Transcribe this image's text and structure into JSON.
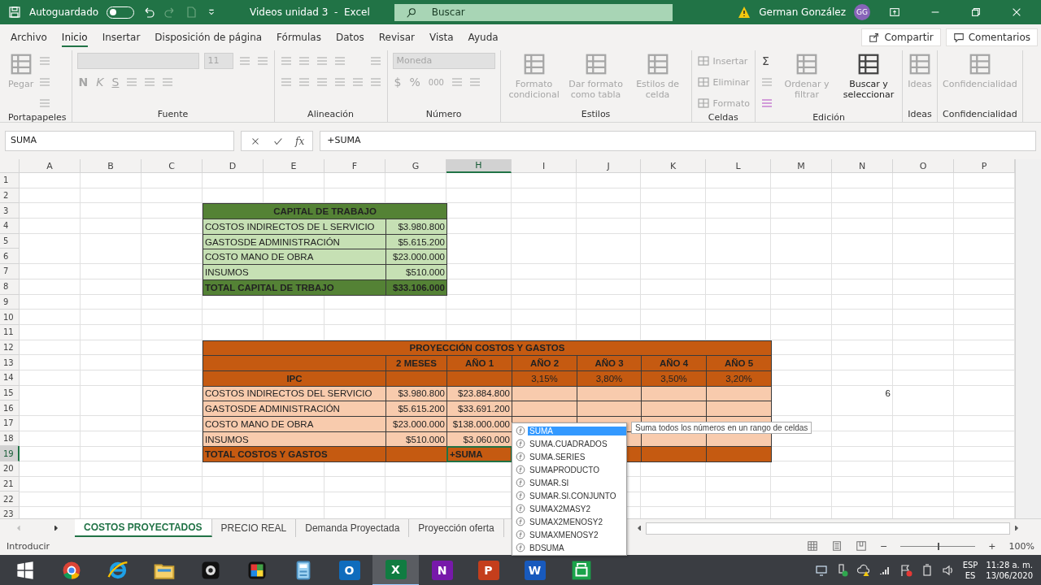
{
  "title_bar": {
    "autosave_label": "Autoguardado",
    "autosave_on": false,
    "document_title": "Videos unidad 3  -  Excel",
    "search_placeholder": "Buscar",
    "user_name": "German González",
    "user_initials": "GG"
  },
  "menu_tabs": [
    {
      "label": "Archivo",
      "selected": false
    },
    {
      "label": "Inicio",
      "selected": true
    },
    {
      "label": "Insertar",
      "selected": false
    },
    {
      "label": "Disposición de página",
      "selected": false
    },
    {
      "label": "Fórmulas",
      "selected": false
    },
    {
      "label": "Datos",
      "selected": false
    },
    {
      "label": "Revisar",
      "selected": false
    },
    {
      "label": "Vista",
      "selected": false
    },
    {
      "label": "Ayuda",
      "selected": false
    }
  ],
  "share_button": "Compartir",
  "comments_button": "Comentarios",
  "ribbon": {
    "disabled": true,
    "groups": [
      {
        "label": "Portapapeles",
        "columns": [
          [
            [
              {
                "kind": "big",
                "label": "Pegar"
              }
            ]
          ],
          [
            [
              {
                "kind": "icon"
              }
            ],
            [
              {
                "kind": "icon"
              }
            ],
            [
              {
                "kind": "icon"
              }
            ]
          ]
        ]
      },
      {
        "label": "Fuente",
        "columns": [
          [
            [
              {
                "kind": "font_field"
              },
              {
                "kind": "size_field",
                "value": "11"
              },
              {
                "kind": "icon"
              },
              {
                "kind": "icon"
              }
            ],
            [
              {
                "kind": "bold_glyph",
                "text": "N"
              },
              {
                "kind": "italic_glyph",
                "text": "K"
              },
              {
                "kind": "underline_glyph",
                "text": "S"
              },
              {
                "kind": "icon"
              },
              {
                "kind": "icon"
              },
              {
                "kind": "icon"
              }
            ]
          ]
        ]
      },
      {
        "label": "Alineación",
        "columns": [
          [
            [
              {
                "kind": "icon"
              },
              {
                "kind": "icon"
              },
              {
                "kind": "icon"
              },
              {
                "kind": "icon"
              }
            ],
            [
              {
                "kind": "icon"
              },
              {
                "kind": "icon"
              },
              {
                "kind": "icon"
              },
              {
                "kind": "icon"
              },
              {
                "kind": "icon"
              }
            ]
          ],
          [
            [
              {
                "kind": "icon"
              }
            ],
            [
              {
                "kind": "icon"
              }
            ]
          ]
        ]
      },
      {
        "label": "Número",
        "columns": [
          [
            [
              {
                "kind": "format_field",
                "value": "Moneda"
              }
            ],
            [
              {
                "kind": "glyph",
                "text": "$"
              },
              {
                "kind": "glyph",
                "text": "%"
              },
              {
                "kind": "small_glyph",
                "text": "000"
              },
              {
                "kind": "icon"
              },
              {
                "kind": "icon"
              }
            ]
          ]
        ]
      },
      {
        "label": "Estilos",
        "columns": [
          [
            [
              {
                "kind": "big",
                "label": "Formato condicional"
              }
            ]
          ],
          [
            [
              {
                "kind": "big",
                "label": "Dar formato como tabla"
              }
            ]
          ],
          [
            [
              {
                "kind": "big",
                "label": "Estilos de celda"
              }
            ]
          ]
        ]
      },
      {
        "label": "Celdas",
        "columns": [
          [
            [
              {
                "kind": "small",
                "label": "Insertar"
              }
            ],
            [
              {
                "kind": "small",
                "label": "Eliminar"
              }
            ],
            [
              {
                "kind": "small",
                "label": "Formato"
              }
            ]
          ]
        ]
      },
      {
        "label": "Edición",
        "columns": [
          [
            [
              {
                "kind": "glyph",
                "text": "Σ",
                "disabled": false
              }
            ],
            [
              {
                "kind": "icon"
              }
            ],
            [
              {
                "kind": "icon",
                "disabled": false
              }
            ]
          ],
          [
            [
              {
                "kind": "big",
                "label": "Ordenar y filtrar"
              }
            ]
          ],
          [
            [
              {
                "kind": "big",
                "label": "Buscar y seleccionar",
                "disabled": false
              }
            ]
          ]
        ]
      },
      {
        "label": "Ideas",
        "columns": [
          [
            [
              {
                "kind": "big",
                "label": "Ideas"
              }
            ]
          ]
        ]
      },
      {
        "label": "Confidencialidad",
        "columns": [
          [
            [
              {
                "kind": "big",
                "label": "Confidencialidad"
              }
            ]
          ]
        ]
      }
    ]
  },
  "formula_bar": {
    "name_box": "SUMA",
    "function_label": "fx",
    "formula": "+SUMA"
  },
  "sheet": {
    "columns": [
      {
        "letter": "A",
        "selected": false
      },
      {
        "letter": "B",
        "selected": false
      },
      {
        "letter": "C",
        "selected": false
      },
      {
        "letter": "D",
        "selected": false
      },
      {
        "letter": "E",
        "selected": false
      },
      {
        "letter": "F",
        "selected": false
      },
      {
        "letter": "G",
        "selected": false
      },
      {
        "letter": "H",
        "selected": true
      },
      {
        "letter": "I",
        "selected": false
      },
      {
        "letter": "J",
        "selected": false
      },
      {
        "letter": "K",
        "selected": false
      },
      {
        "letter": "L",
        "selected": false
      },
      {
        "letter": "M",
        "selected": false
      },
      {
        "letter": "N",
        "selected": false
      },
      {
        "letter": "O",
        "selected": false
      },
      {
        "letter": "P",
        "selected": false
      }
    ],
    "rows": [
      {
        "number": "1",
        "selected": false
      },
      {
        "number": "2",
        "selected": false
      },
      {
        "number": "3",
        "selected": false
      },
      {
        "number": "4",
        "selected": false
      },
      {
        "number": "5",
        "selected": false
      },
      {
        "number": "6",
        "selected": false
      },
      {
        "number": "7",
        "selected": false
      },
      {
        "number": "8",
        "selected": false
      },
      {
        "number": "9",
        "selected": false
      },
      {
        "number": "10",
        "selected": false
      },
      {
        "number": "11",
        "selected": false
      },
      {
        "number": "12",
        "selected": false
      },
      {
        "number": "13",
        "selected": false
      },
      {
        "number": "14",
        "selected": false
      },
      {
        "number": "15",
        "selected": false
      },
      {
        "number": "16",
        "selected": false
      },
      {
        "number": "17",
        "selected": false
      },
      {
        "number": "18",
        "selected": false
      },
      {
        "number": "19",
        "selected": true
      },
      {
        "number": "20",
        "selected": false
      },
      {
        "number": "21",
        "selected": false
      },
      {
        "number": "22",
        "selected": false
      },
      {
        "number": "23",
        "selected": false
      }
    ],
    "capital_table": {
      "title": "CAPITAL DE TRABAJO",
      "rows": [
        {
          "label": "COSTOS INDIRECTOS DE L SERVICIO",
          "value": "$3.980.800"
        },
        {
          "label": "GASTOSDE ADMINISTRACIÓN",
          "value": "$5.615.200"
        },
        {
          "label": "COSTO MANO DE OBRA",
          "value": "$23.000.000"
        },
        {
          "label": "INSUMOS",
          "value": "$510.000"
        }
      ],
      "total": {
        "label": "TOTAL CAPITAL DE TRBAJO",
        "value": "$33.106.000"
      }
    },
    "projection_table": {
      "title": "PROYECCIÓN COSTOS Y GASTOS",
      "column_headers": [
        "2 MESES",
        "AÑO 1",
        "AÑO 2",
        "AÑO 3",
        "AÑO 4",
        "AÑO 5"
      ],
      "ipc_label": "IPC",
      "ipc_rates": [
        "3,15%",
        "3,80%",
        "3,50%",
        "3,20%"
      ],
      "rows": [
        {
          "label": "COSTOS INDIRECTOS DEL SERVICIO",
          "values": [
            "$3.980.800",
            "$23.884.800"
          ]
        },
        {
          "label": "GASTOSDE ADMINISTRACIÓN",
          "values": [
            "$5.615.200",
            "$33.691.200"
          ]
        },
        {
          "label": "COSTO MANO DE OBRA",
          "values": [
            "$23.000.000",
            "$138.000.000"
          ]
        },
        {
          "label": "INSUMOS",
          "values": [
            "$510.000",
            "$3.060.000"
          ]
        }
      ],
      "total": {
        "label": "TOTAL COSTOS Y GASTOS",
        "editing_value": "+SUMA"
      }
    },
    "stray_cell_value": "6"
  },
  "autocomplete": {
    "items": [
      {
        "name": "SUMA",
        "selected": true
      },
      {
        "name": "SUMA.CUADRADOS",
        "selected": false
      },
      {
        "name": "SUMA.SERIES",
        "selected": false
      },
      {
        "name": "SUMAPRODUCTO",
        "selected": false
      },
      {
        "name": "SUMAR.SI",
        "selected": false
      },
      {
        "name": "SUMAR.SI.CONJUNTO",
        "selected": false
      },
      {
        "name": "SUMAX2MASY2",
        "selected": false
      },
      {
        "name": "SUMAX2MENOSY2",
        "selected": false
      },
      {
        "name": "SUMAXMENOSY2",
        "selected": false
      },
      {
        "name": "BDSUMA",
        "selected": false
      }
    ],
    "tooltip": "Suma todos los números en un rango de celdas"
  },
  "sheet_tabs": [
    {
      "label": "COSTOS PROYECTADOS",
      "selected": true
    },
    {
      "label": "PRECIO REAL",
      "selected": false
    },
    {
      "label": "Demanda Proyectada",
      "selected": false
    },
    {
      "label": "Proyección oferta",
      "selected": false
    }
  ],
  "status_bar": {
    "mode": "Introducir",
    "zoom_minus": "−",
    "zoom_plus": "+",
    "zoom": {
      "level": 0.5
    },
    "zoom_label": "100%"
  },
  "taskbar": {
    "apps": [
      {
        "kind": "start",
        "selected": false
      },
      {
        "kind": "chrome",
        "selected": false
      },
      {
        "kind": "ie",
        "selected": false
      },
      {
        "kind": "explorer",
        "selected": false
      },
      {
        "kind": "camera",
        "selected": false
      },
      {
        "kind": "puzzle",
        "selected": false
      },
      {
        "kind": "calculator",
        "selected": false
      },
      {
        "kind": "letter",
        "letter": "O",
        "color": "#0f6cbd",
        "selected": false
      },
      {
        "kind": "letter",
        "letter": "X",
        "color": "#107c41",
        "selected": true
      },
      {
        "kind": "letter",
        "letter": "N",
        "color": "#7719aa",
        "selected": false
      },
      {
        "kind": "letter",
        "letter": "P",
        "color": "#c43e1c",
        "selected": false
      },
      {
        "kind": "letter",
        "letter": "W",
        "color": "#185abd",
        "selected": false
      },
      {
        "kind": "store",
        "selected": false
      }
    ],
    "language_top": "ESP",
    "language_bottom": "ES",
    "time": "11:28 a. m.",
    "date": "13/06/2020"
  }
}
